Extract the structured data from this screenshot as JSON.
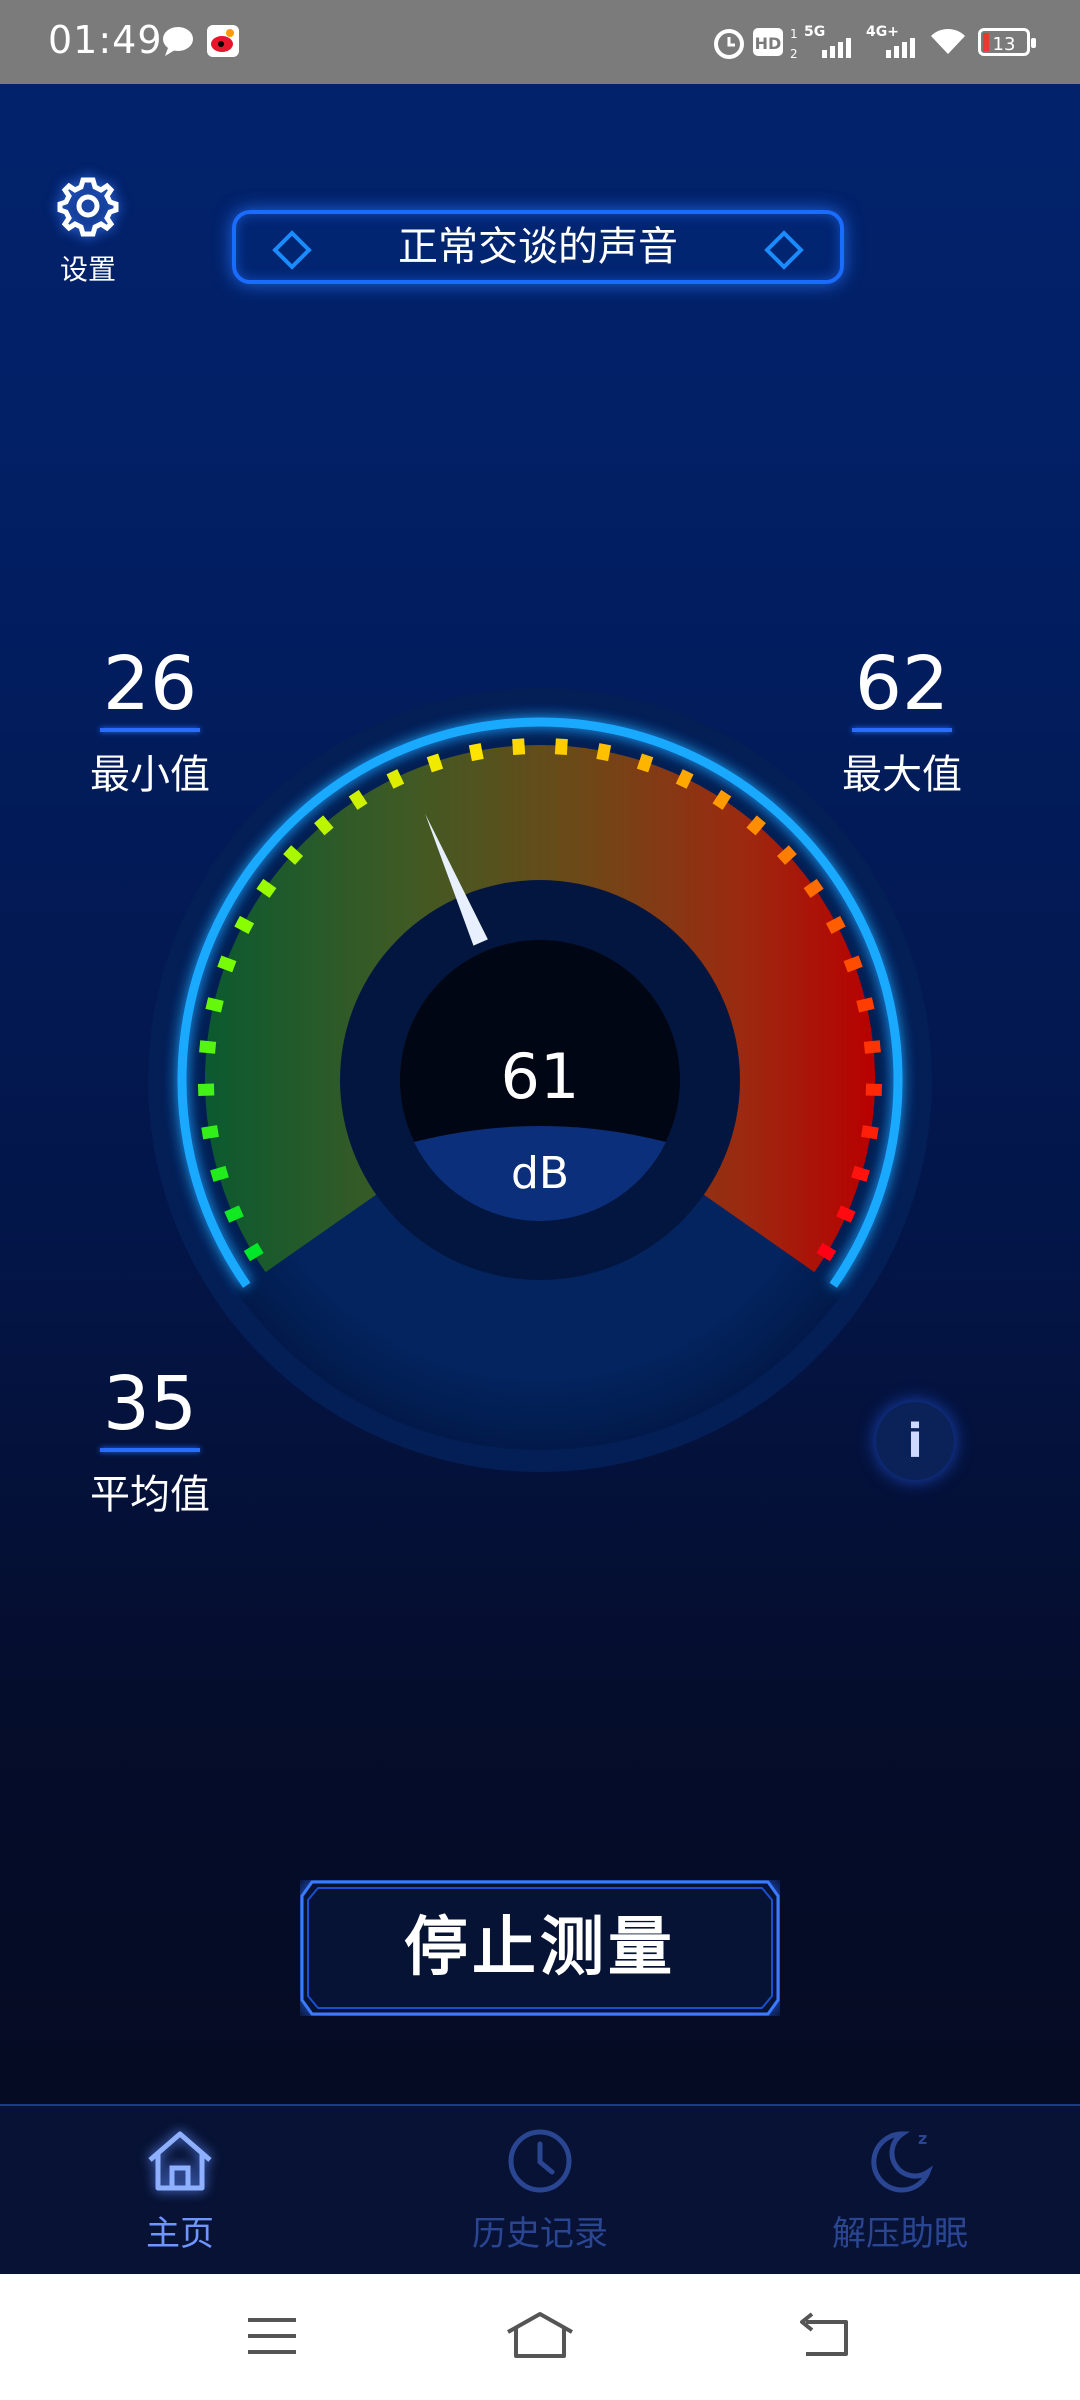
{
  "status_bar": {
    "time": "01:49",
    "battery": "13",
    "icons": [
      "chat-bubble-icon",
      "weibo-icon",
      "alarm-icon",
      "hd-icon",
      "5g-signal-icon",
      "4g-signal-icon",
      "wifi-icon",
      "battery-icon"
    ]
  },
  "header": {
    "settings_label": "设置",
    "banner_text": "正常交谈的声音"
  },
  "stats": {
    "min_value": "26",
    "min_label": "最小值",
    "max_value": "62",
    "max_label": "最大值",
    "avg_value": "35",
    "avg_label": "平均值"
  },
  "gauge": {
    "value": "61",
    "unit": "dB",
    "needle_level": 61
  },
  "actions": {
    "stop_label": "停止测量",
    "info_label": "i"
  },
  "tabs": [
    {
      "label": "主页",
      "icon": "home-icon",
      "active": true
    },
    {
      "label": "历史记录",
      "icon": "clock-icon",
      "active": false
    },
    {
      "label": "解压助眠",
      "icon": "moon-icon",
      "active": false
    }
  ],
  "colors": {
    "accent": "#1a6cff",
    "active_tab": "#6f95ff",
    "inactive_tab": "#2a4592"
  }
}
